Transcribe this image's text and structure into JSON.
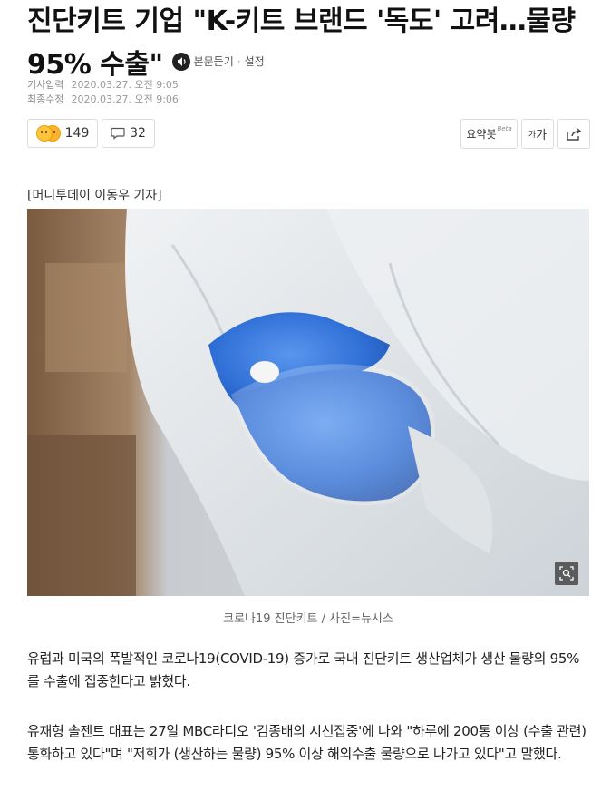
{
  "article": {
    "title": "진단키트 기업 \"K-키트 브랜드 '독도' 고려…물량 95% 수출\"",
    "listen_label": "본문듣기",
    "settings_label": "설정",
    "meta": {
      "input_label": "기사입력",
      "input_value": "2020.03.27. 오전 9:05",
      "modified_label": "최종수정",
      "modified_value": "2020.03.27. 오전 9:06"
    },
    "reactions": {
      "count": "149"
    },
    "comments": {
      "count": "32"
    },
    "toolbar": {
      "summary_label": "요약봇",
      "summary_badge": "Beta",
      "font_small": "가",
      "font_big": "가"
    },
    "reporter": "[머니투데이 이동우 기자]",
    "photo": {
      "caption": "코로나19 진단키트 / 사진=뉴시스"
    },
    "paragraphs": [
      "유럽과 미국의 폭발적인 코로나19(COVID-19) 증가로 국내 진단키트 생산업체가 생산 물량의 95%를 수출에 집중한다고 밝혔다.",
      "유재형 솔젠트 대표는 27일 MBC라디오 '김종배의 시선집중'에 나와 \"하루에 200통 이상 (수출 관련) 통화하고 있다\"며 \"저희가 (생산하는 물량) 95% 이상 해외수출 물량으로 나가고 있다\"고 말했다."
    ]
  },
  "colors": {
    "glove_blue": "#2f6fd6",
    "ppe_white": "#e7ebee",
    "box_brown": "#8a6848"
  }
}
